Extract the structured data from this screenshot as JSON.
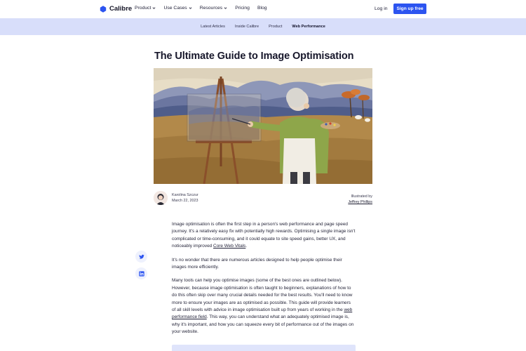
{
  "brand": {
    "name": "Calibre",
    "accent": "#2c54f0"
  },
  "nav": {
    "items": [
      {
        "label": "Product",
        "has_menu": true
      },
      {
        "label": "Use Cases",
        "has_menu": true
      },
      {
        "label": "Resources",
        "has_menu": true
      },
      {
        "label": "Pricing",
        "has_menu": false
      },
      {
        "label": "Blog",
        "has_menu": false
      }
    ],
    "login": "Log in",
    "signup": "Sign up free"
  },
  "subnav": {
    "items": [
      "Latest Articles",
      "Inside Calibre",
      "Product",
      "Web Performance"
    ],
    "active": "Web Performance"
  },
  "article": {
    "title": "The Ultimate Guide to Image Optimisation",
    "author": "Karolina Szczur",
    "date": "March 22, 2023",
    "illustrated_label": "Illustrated by",
    "illustrator": "Jeffrey Phillips",
    "p1_before": "Image optimisation is often the first step in a person's web performance and page speed journey. It's a relatively easy fix with potentially high rewards. Optimising a single image isn't complicated or time-consuming, and it could equate to site speed gains, better UX, and noticeably improved ",
    "p1_link": "Core Web Vitals",
    "p1_after": ".",
    "p2": "It's no wonder that there are numerous articles designed to help people optimise their images more efficiently.",
    "p3_before": "Many tools can help you optimise images (some of the best ones are outlined below). However, because image optimisation is often taught to beginners, explanations of how to do this often skip over many crucial details needed for the best results. You'll need to know more to ensure your images are as optimised as possible. This guide will provide learners of all skill levels with advice in image optimisation built up from years of working in the ",
    "p3_link": "web performance field",
    "p3_after": ". This way, you can understand what an adequately optimised image is, why it's important, and how you can squeeze every bit of performance out of the images on your website."
  },
  "share": [
    "twitter-icon",
    "linkedin-icon"
  ]
}
